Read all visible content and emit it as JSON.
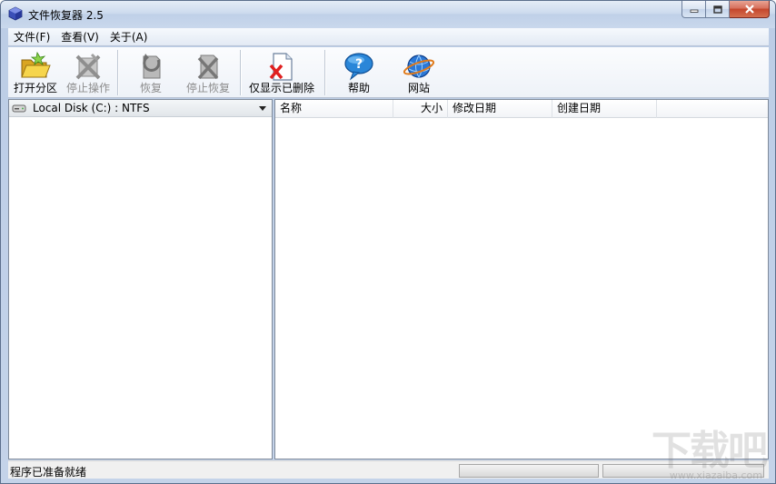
{
  "window": {
    "title": "文件恢复器 2.5",
    "controls": [
      "minimize",
      "maximize",
      "close"
    ]
  },
  "menu": {
    "items": [
      "文件(F)",
      "查看(V)",
      "关于(A)"
    ]
  },
  "toolbar": {
    "buttons": [
      {
        "label": "打开分区",
        "icon": "folder-open-icon",
        "enabled": true
      },
      {
        "label": "停止操作",
        "icon": "stop-operation-icon",
        "enabled": false
      },
      {
        "label": "恢复",
        "icon": "restore-icon",
        "enabled": false
      },
      {
        "label": "停止恢复",
        "icon": "stop-restore-icon",
        "enabled": false
      },
      {
        "label": "仅显示已删除",
        "icon": "deleted-file-icon",
        "enabled": true
      },
      {
        "label": "帮助",
        "icon": "help-icon",
        "enabled": true
      },
      {
        "label": "网站",
        "icon": "website-globe-icon",
        "enabled": true
      }
    ]
  },
  "drive_selector": {
    "selected": "Local Disk (C:) : NTFS"
  },
  "file_list": {
    "columns": [
      "名称",
      "大小",
      "修改日期",
      "创建日期"
    ],
    "rows": []
  },
  "status": {
    "text": "程序已准备就绪"
  },
  "watermark": {
    "text": "下载吧",
    "sub": "www.xiazaiba.com"
  },
  "colors": {
    "title_gradient_top": "#e4ecf6",
    "close_button": "#c4452c",
    "pane_border": "#7f8a9a"
  }
}
